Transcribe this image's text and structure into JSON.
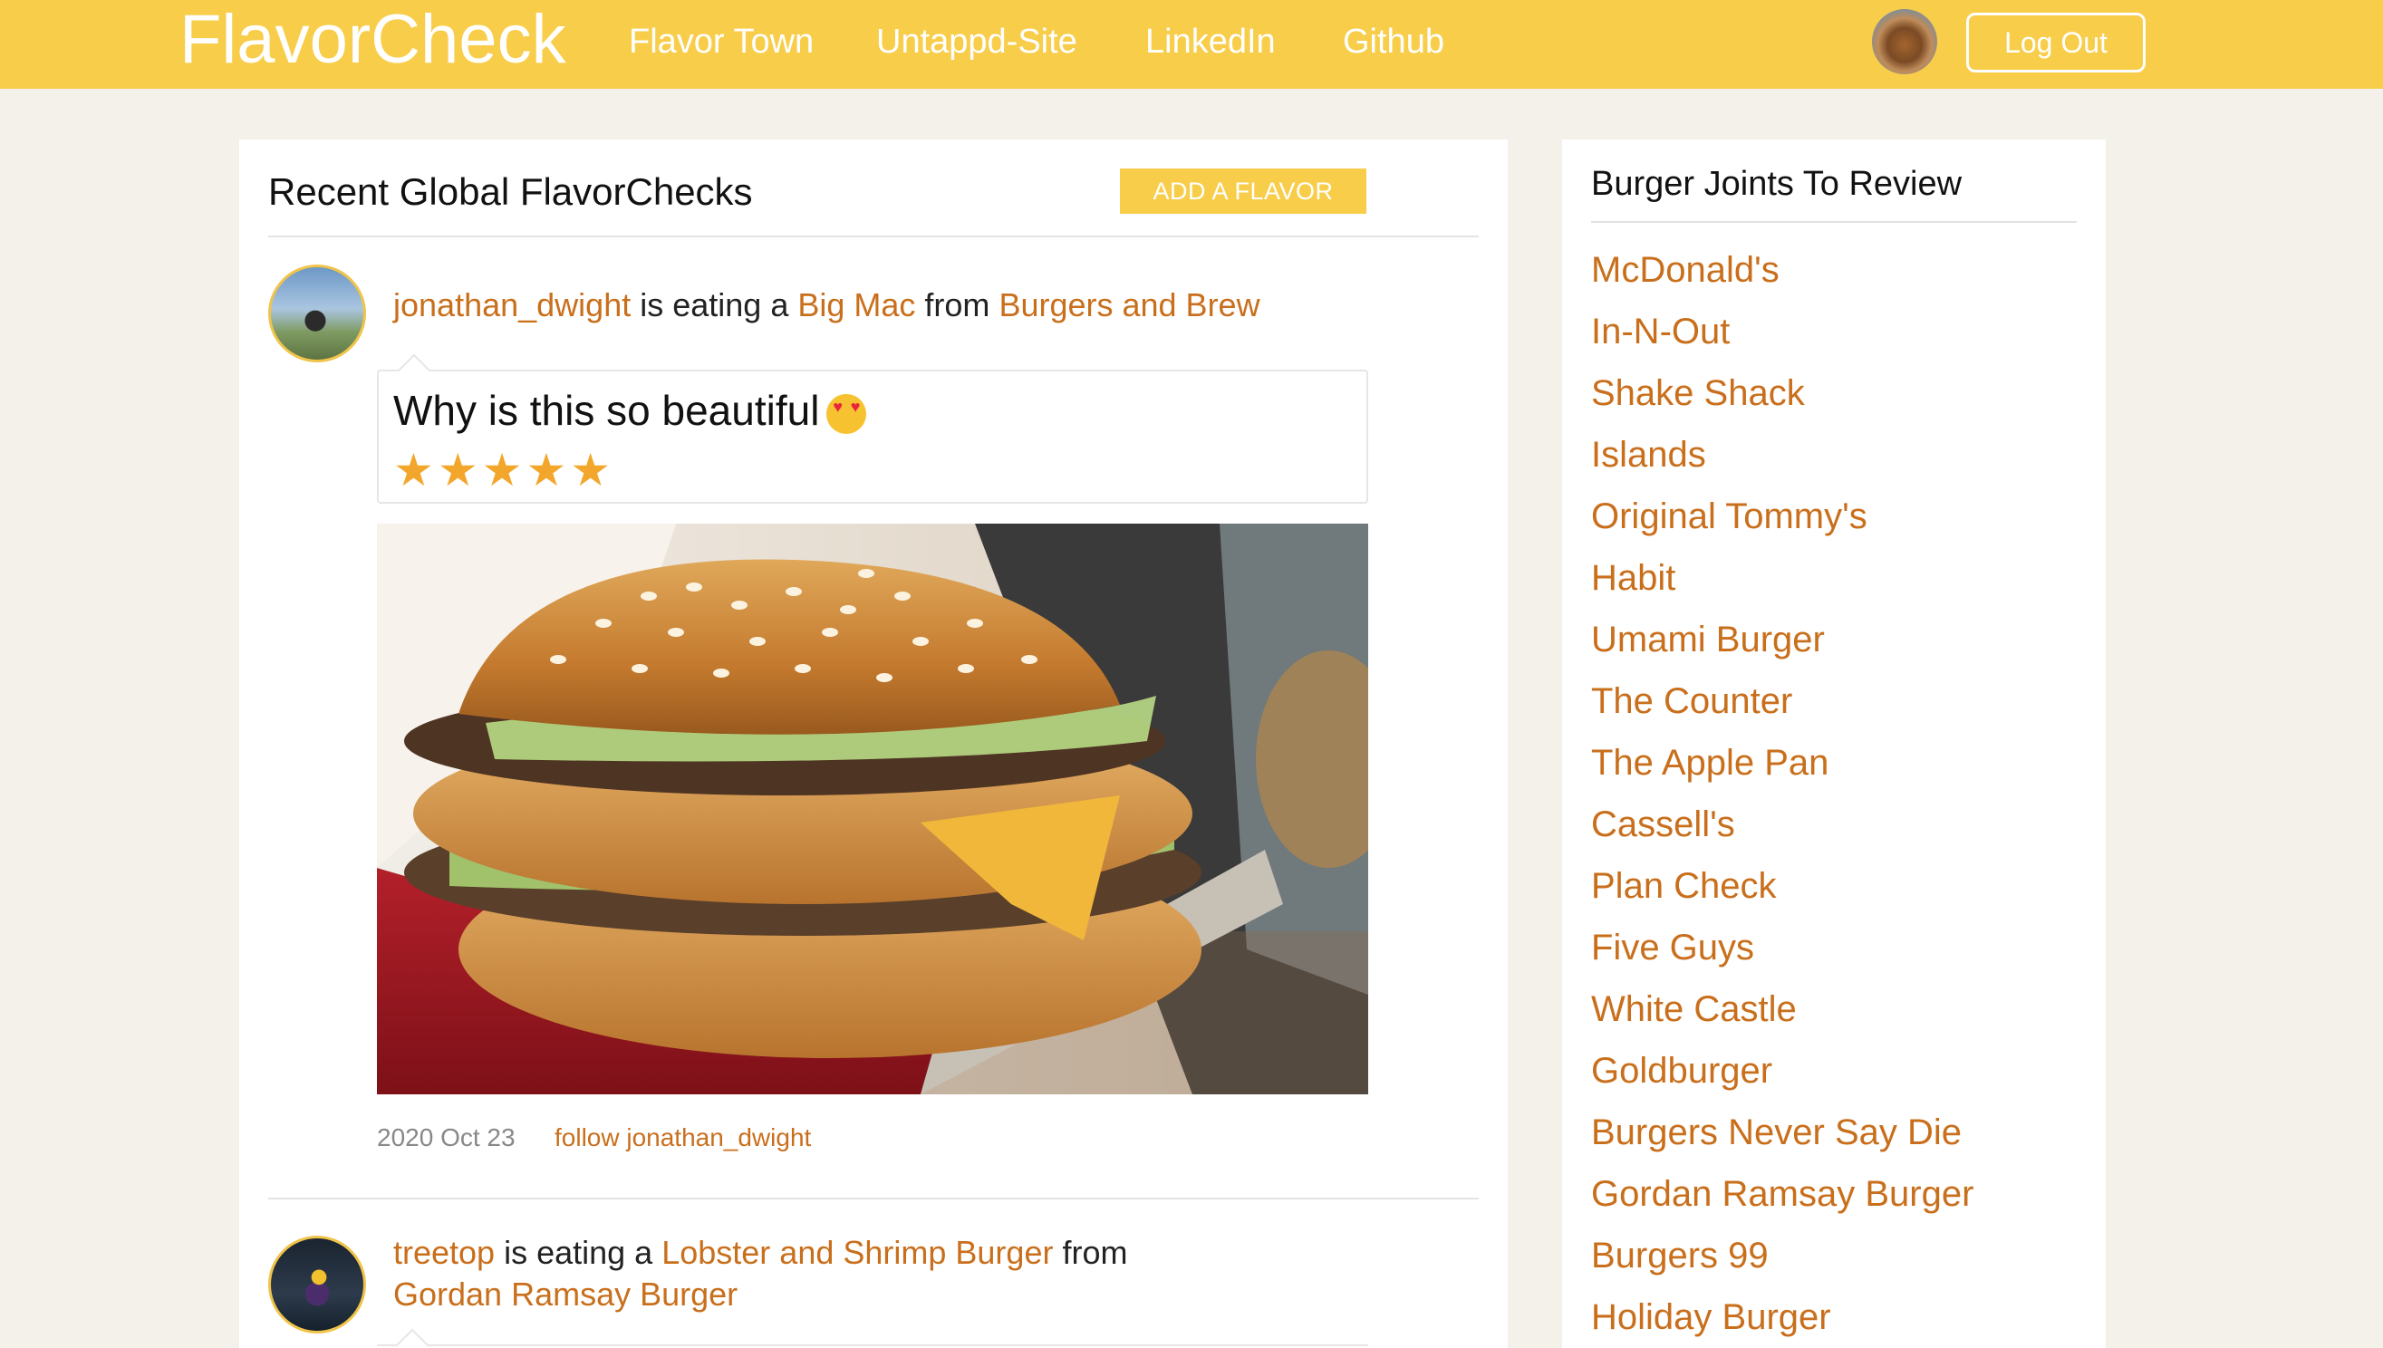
{
  "navbar": {
    "brand": "FlavorCheck",
    "links": [
      "Flavor Town",
      "Untappd-Site",
      "LinkedIn",
      "Github"
    ],
    "logout_label": "Log Out"
  },
  "feed": {
    "title": "Recent Global FlavorChecks",
    "add_button_label": "ADD A FLAVOR",
    "posts": [
      {
        "user": "jonathan_dwight",
        "eating_text": "is eating a",
        "item": "Big Mac",
        "from_text": "from",
        "venue": "Burgers and Brew",
        "comment": "Why is this so beautiful",
        "emoji": "heart-eyes-emoji",
        "rating": 5,
        "rating_display": "★★★★★",
        "date": "2020 Oct 23",
        "follow_label": "follow jonathan_dwight"
      },
      {
        "user": "treetop",
        "eating_text": "is eating a",
        "item": "Lobster and Shrimp Burger",
        "from_text": "from",
        "venue": "Gordan Ramsay Burger"
      }
    ]
  },
  "sidebar": {
    "title": "Burger Joints To Review",
    "joints": [
      "McDonald's",
      "In-N-Out",
      "Shake Shack",
      "Islands",
      "Original Tommy's",
      "Habit",
      "Umami Burger",
      "The Counter",
      "The Apple Pan",
      "Cassell's",
      "Plan Check",
      "Five Guys",
      "White Castle",
      "Goldburger",
      "Burgers Never Say Die",
      "Gordan Ramsay Burger",
      "Burgers 99",
      "Holiday Burger"
    ]
  },
  "colors": {
    "navbar": "#f8cd4a",
    "accent_link": "#c96f1c",
    "stars": "#f2a72c",
    "page_background": "#f4f1ea"
  }
}
